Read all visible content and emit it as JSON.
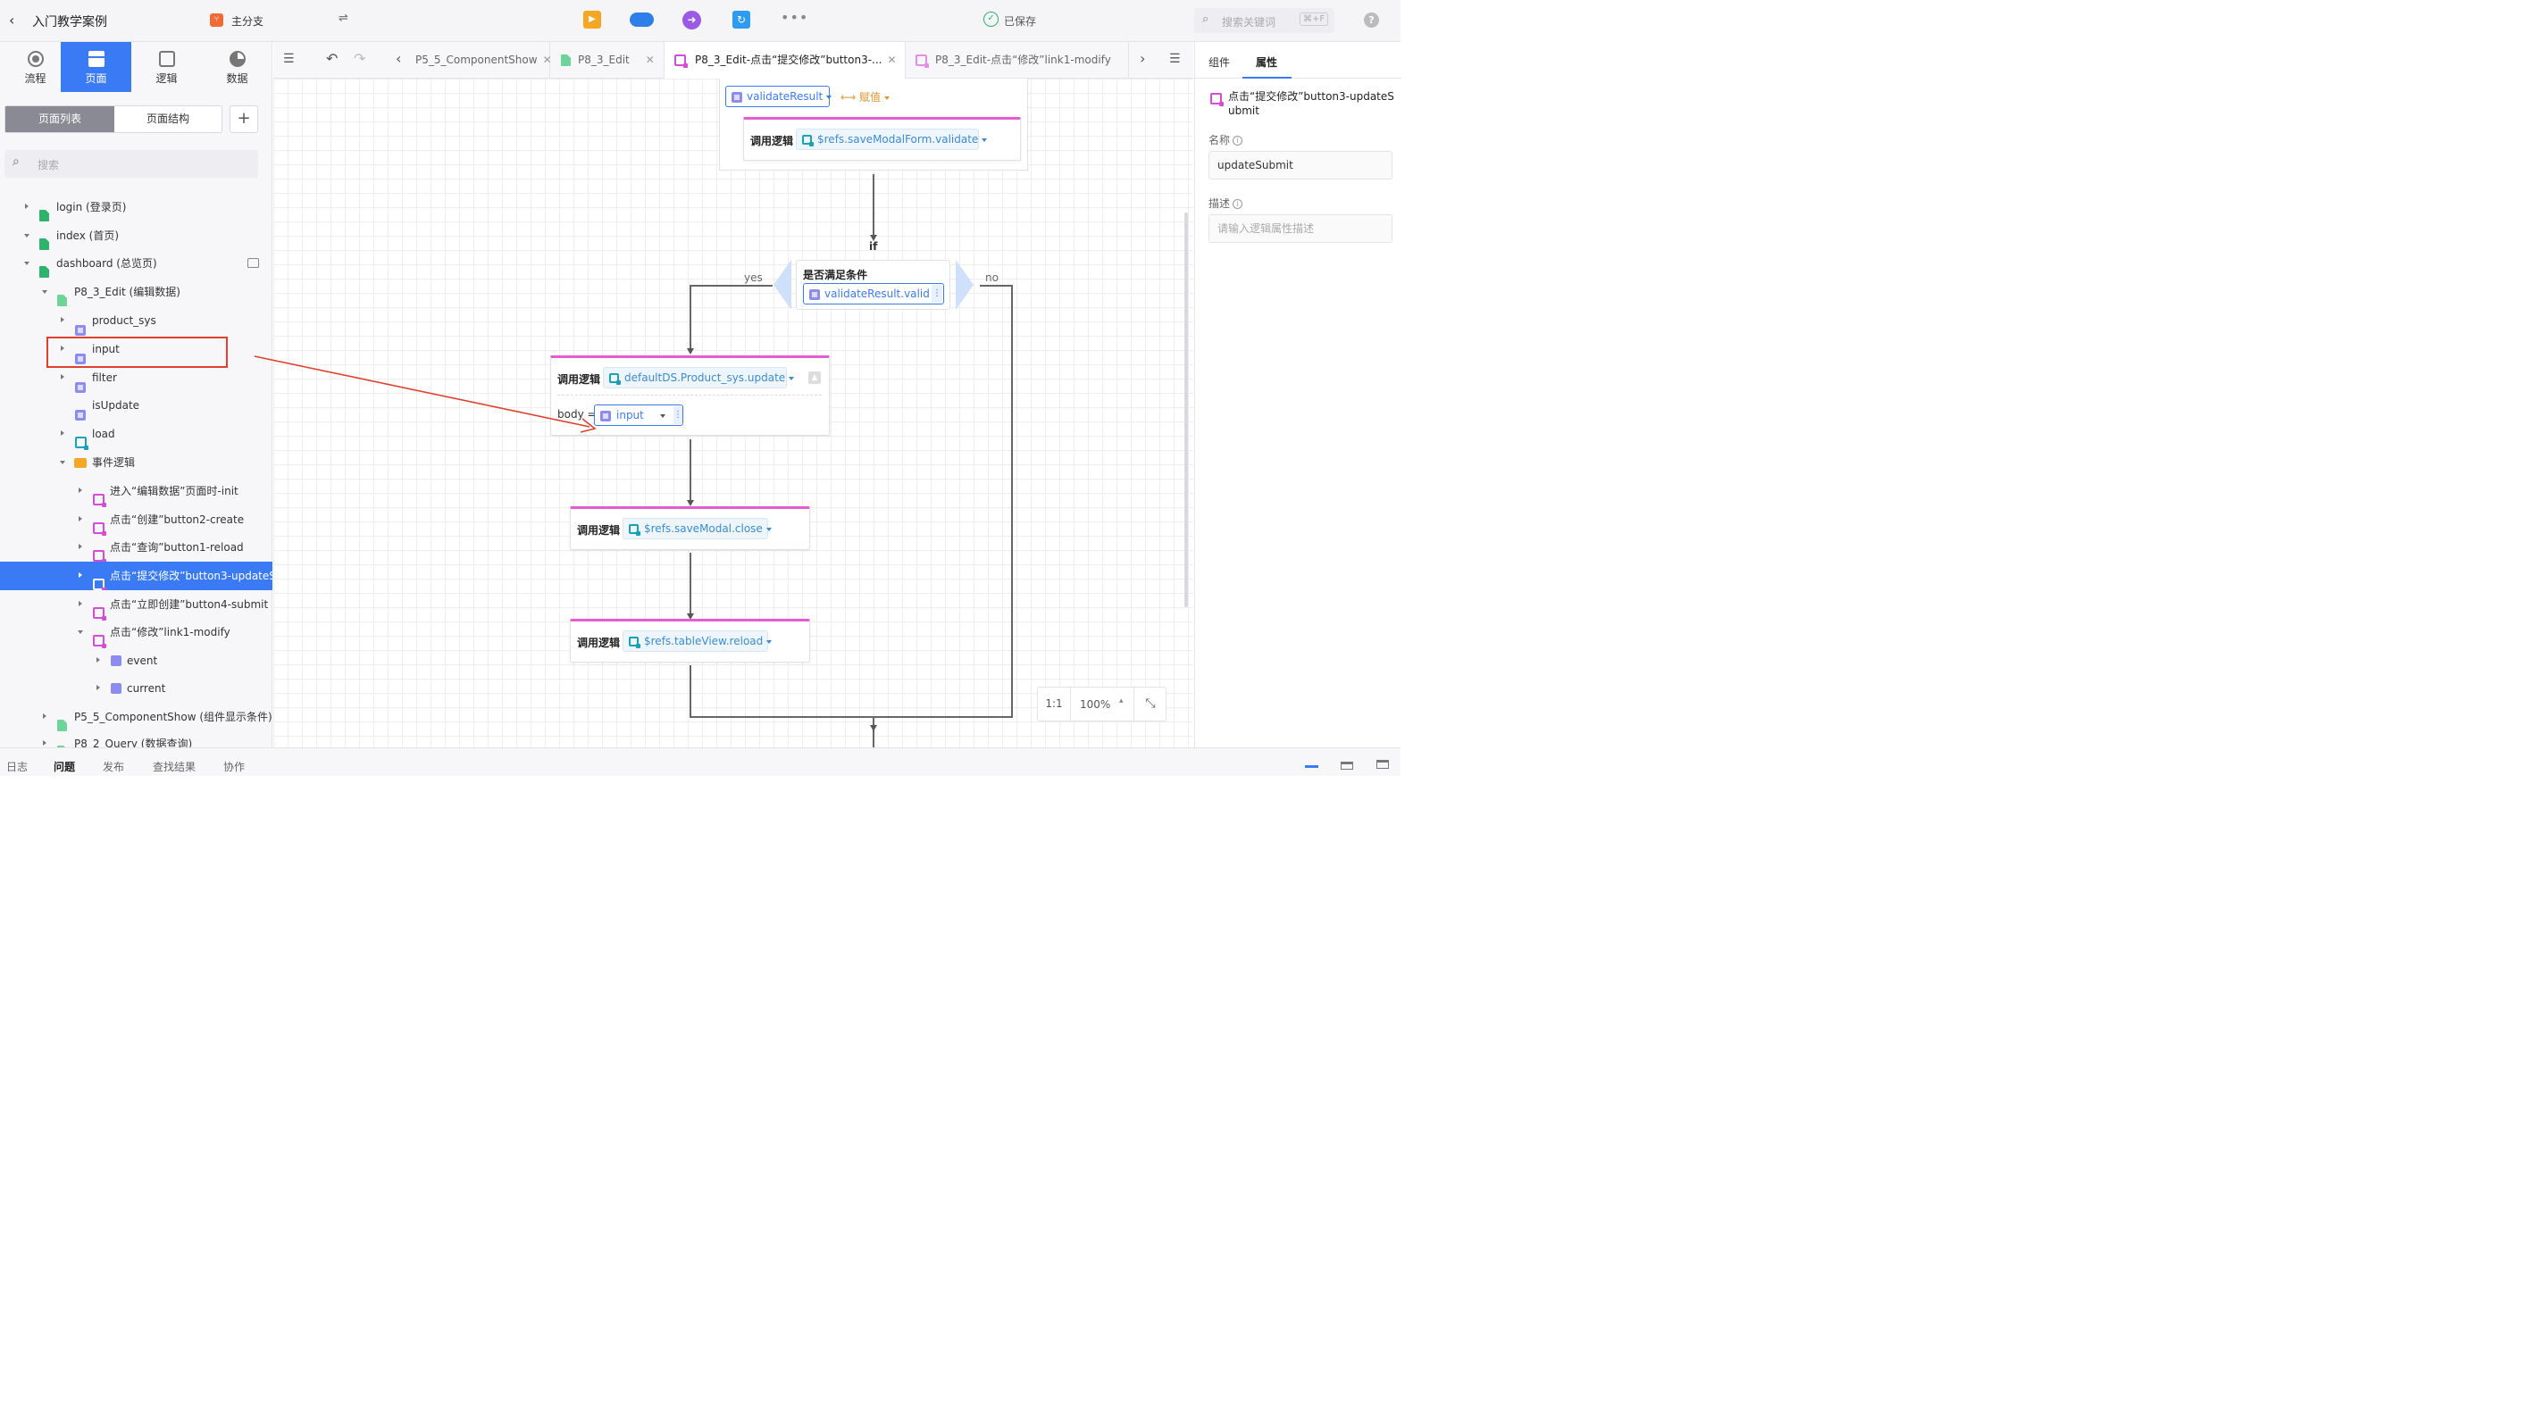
{
  "app": {
    "title": "入门教学案例",
    "branch": "主分支",
    "save_status": "已保存",
    "search_placeholder": "搜索关键词",
    "search_shortcut": "⌘+F",
    "help": "?"
  },
  "nav_tabs": [
    {
      "label": "流程"
    },
    {
      "label": "页面"
    },
    {
      "label": "逻辑"
    },
    {
      "label": "数据"
    }
  ],
  "left_panel": {
    "segment_list": "页面列表",
    "segment_structure": "页面结构",
    "add": "+",
    "search_placeholder": "搜索",
    "tree": [
      {
        "label": "login (登录页)"
      },
      {
        "label": "index (首页)"
      },
      {
        "label": "dashboard (总览页)"
      },
      {
        "label": "P8_3_Edit (编辑数据)"
      },
      {
        "label": "product_sys"
      },
      {
        "label": "input"
      },
      {
        "label": "filter"
      },
      {
        "label": "isUpdate"
      },
      {
        "label": "load"
      },
      {
        "label": "事件逻辑"
      },
      {
        "label": "进入“编辑数据”页面时-init"
      },
      {
        "label": "点击“创建”button2-create"
      },
      {
        "label": "点击“查询”button1-reload"
      },
      {
        "label": "点击“提交修改”button3-updateSubmit"
      },
      {
        "label": "点击“立即创建”button4-submit"
      },
      {
        "label": "点击“修改”link1-modify"
      },
      {
        "label": "event"
      },
      {
        "label": "current"
      },
      {
        "label": "P5_5_ComponentShow (组件显示条件)"
      },
      {
        "label": "P8_2_Query (数据查询)"
      }
    ]
  },
  "tabs": [
    {
      "label": "P5_5_ComponentShow"
    },
    {
      "label": "P8_3_Edit"
    },
    {
      "label": "P8_3_Edit-点击“提交修改”button3-..."
    },
    {
      "label": "P8_3_Edit-点击“修改”link1-modify"
    }
  ],
  "canvas": {
    "assign_var": "validateResult",
    "assign_op": "赋值",
    "card1_label": "调用逻辑",
    "card1_target": "$refs.saveModalForm.validate",
    "if_label": "if",
    "cond_title": "是否满足条件",
    "cond_var": "validateResult.valid",
    "yes": "yes",
    "no": "no",
    "card2_label": "调用逻辑",
    "card2_target": "defaultDS.Product_sys.update",
    "card2_param": "body =",
    "card2_value": "input",
    "card3_label": "调用逻辑",
    "card3_target": "$refs.saveModal.close",
    "card4_label": "调用逻辑",
    "card4_target": "$refs.tableView.reload",
    "zoom_ratio": "1:1",
    "zoom_level": "100%"
  },
  "right_panel": {
    "tab_components": "组件",
    "tab_properties": "属性",
    "logic_title": "点击“提交修改”button3-updateSubmit",
    "name_label": "名称",
    "name_value": "updateSubmit",
    "desc_label": "描述",
    "desc_placeholder": "请输入逻辑属性描述"
  },
  "bottom_tabs": [
    {
      "label": "日志"
    },
    {
      "label": "问题"
    },
    {
      "label": "发布"
    },
    {
      "label": "查找结果"
    },
    {
      "label": "协作"
    }
  ],
  "colors": {
    "accent": "#3a7bf5",
    "logic_pink": "#e65bd2",
    "page_green": "#2db36b",
    "annotation_red": "#e0402c"
  }
}
